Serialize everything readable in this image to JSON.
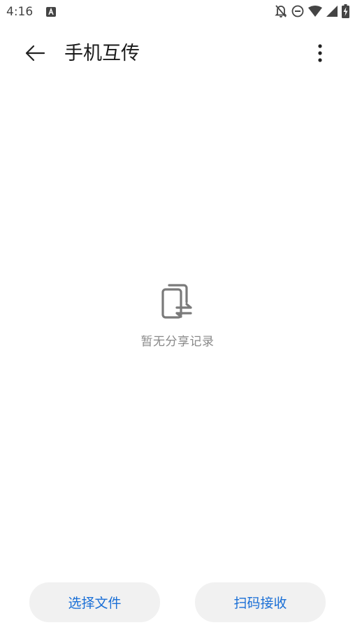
{
  "status_bar": {
    "time": "4:16",
    "icons": [
      "app-a-icon",
      "bell-off-icon",
      "do-not-disturb-icon",
      "wifi-icon",
      "cell-signal-icon",
      "battery-charging-icon"
    ]
  },
  "app_bar": {
    "back_icon": "arrow-back-icon",
    "title": "手机互传",
    "more_icon": "more-vert-icon"
  },
  "empty_state": {
    "icon": "phone-transfer-icon",
    "text": "暂无分享记录"
  },
  "actions": {
    "select_files": "选择文件",
    "scan_receive": "扫码接收"
  },
  "colors": {
    "accent": "#1a6fd6",
    "button_bg": "#f1f1f1",
    "muted_text": "#8a8a8a"
  }
}
